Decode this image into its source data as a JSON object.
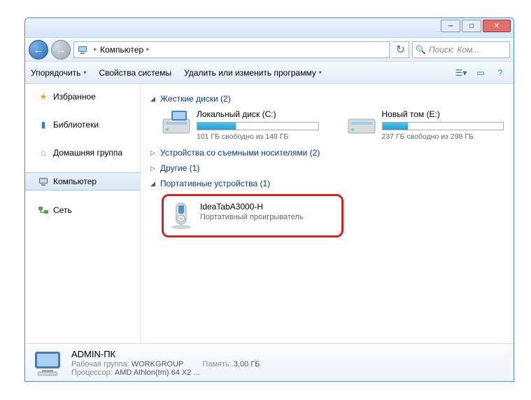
{
  "breadcrumb": {
    "root": "Компьютер"
  },
  "search": {
    "placeholder": "Поиск: Ком..."
  },
  "toolbar": {
    "organize": "Упорядочить",
    "properties": "Свойства системы",
    "uninstall": "Удалить или изменить программу"
  },
  "sidebar": {
    "favorites": "Избранное",
    "libraries": "Библиотеки",
    "homegroup": "Домашняя группа",
    "computer": "Компьютер",
    "network": "Сеть"
  },
  "sections": {
    "harddrives": {
      "label": "Жесткие диски (2)"
    },
    "removable": {
      "label": "Устройства со съемными носителями (2)"
    },
    "other": {
      "label": "Другие (1)"
    },
    "portable": {
      "label": "Портативные устройства (1)"
    }
  },
  "drives": [
    {
      "name": "Локальный диск (C:)",
      "free_text": "101 ГБ свободно из 148 ГБ",
      "fill_pct": 32
    },
    {
      "name": "Новый том (E:)",
      "free_text": "237 ГБ свободно из 298 ГБ",
      "fill_pct": 21
    }
  ],
  "portable_device": {
    "name": "IdeaTabA3000-H",
    "subtitle": "Портативный проигрыватель"
  },
  "details": {
    "computer_name": "ADMIN-ПК",
    "workgroup_label": "Рабочая группа:",
    "workgroup": "WORKGROUP",
    "memory_label": "Память:",
    "memory": "3,00 ГБ",
    "processor_label": "Процессор:",
    "processor": "AMD Athlon(tm) 64 X2 ..."
  }
}
